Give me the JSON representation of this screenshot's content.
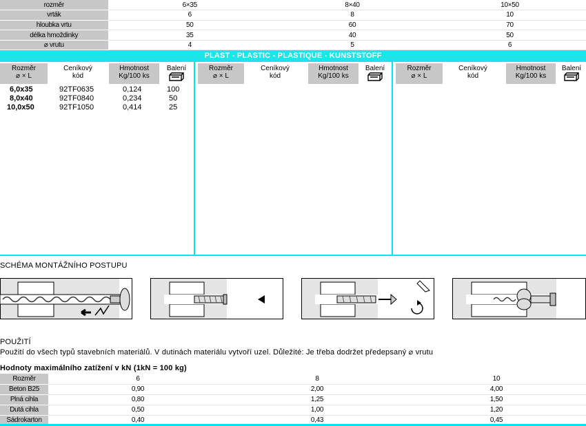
{
  "spec_table": {
    "columns": [
      "6×35",
      "8×40",
      "10×50"
    ],
    "rows": [
      {
        "label": "rozměr",
        "values": [
          "6×35",
          "8×40",
          "10×50"
        ]
      },
      {
        "label": "vrták",
        "values": [
          "6",
          "8",
          "10"
        ]
      },
      {
        "label": "hloubka vrtu",
        "values": [
          "50",
          "60",
          "70"
        ]
      },
      {
        "label": "délka hmoždinky",
        "values": [
          "35",
          "40",
          "50"
        ]
      },
      {
        "label": "⌀ vrutu",
        "values": [
          "4",
          "5",
          "6"
        ]
      }
    ]
  },
  "material_band": "PLAST - PLASTIC - PLASTIQUE - KUNSTSTOFF",
  "product_header": {
    "size_line1": "Rozměr",
    "size_line2": "⌀ × L",
    "code_line1": "Ceníkový",
    "code_line2": "kód",
    "weight_line1": "Hmotnost",
    "weight_line2": "Kg/100 ks",
    "pack": "Balení"
  },
  "products": [
    {
      "size": "6,0x35",
      "code": "92TF0635",
      "weight": "0,124",
      "pack": "100"
    },
    {
      "size": "8,0x40",
      "code": "92TF0840",
      "weight": "0,234",
      "pack": "50"
    },
    {
      "size": "10,0x50",
      "code": "92TF1050",
      "weight": "0,414",
      "pack": "25"
    }
  ],
  "mounting_title": "SCHÉMA MONTÁŽNÍHO POSTUPU",
  "usage_title": "POUŽITÍ",
  "usage_text": "Použití do všech typů stavebních materiálů. V dutinách materiálu vytvoří uzel. Důležité: Je třeba dodržet předepsaný ⌀ vrutu",
  "load_title": "Hodnoty maximálního zatížení v kN (1kN = 100 kg)",
  "load_table": {
    "header_label": "Rozměr",
    "sizes": [
      "6",
      "8",
      "10"
    ],
    "rows": [
      {
        "label": "Beton B25",
        "values": [
          "0,90",
          "2,00",
          "4,00"
        ]
      },
      {
        "label": "Plná cihla",
        "values": [
          "0,80",
          "1,25",
          "1,50"
        ]
      },
      {
        "label": "Dutá cihla",
        "values": [
          "0,50",
          "1,00",
          "1,20"
        ]
      },
      {
        "label": "Sádrokarton",
        "values": [
          "0,40",
          "0,43",
          "0,45"
        ]
      }
    ]
  },
  "colors": {
    "accent": "#1ee3e9",
    "label_bg": "#c7c7c7"
  }
}
